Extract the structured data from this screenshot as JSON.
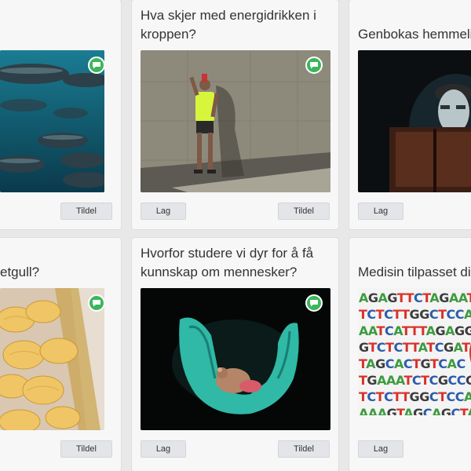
{
  "cards": [
    {
      "id": "fish",
      "title": "",
      "button": "Tildel"
    },
    {
      "id": "energy",
      "title": "Hva skjer med energidrikken i kroppen?",
      "buttons": [
        "Lag",
        "Tildel"
      ]
    },
    {
      "id": "genbok",
      "title": "Genbokas hemmelig",
      "buttons": [
        "Lag"
      ]
    },
    {
      "id": "chips",
      "title": "etgull?",
      "button": "Tildel"
    },
    {
      "id": "mouse",
      "title": "Hvorfor studere vi dyr for å få kunnskap om mennesker?",
      "buttons": [
        "Lag",
        "Tildel"
      ]
    },
    {
      "id": "dna",
      "title": "Medisin tilpasset din",
      "buttons": [
        "Lag"
      ]
    }
  ],
  "icons": {
    "discussion": "chat-bubble-icon"
  },
  "colors": {
    "accent": "#3bb65b",
    "card_bg": "#f7f7f7",
    "page_bg": "#e8e8e8",
    "button_bg": "#e3e5e8"
  },
  "dna_sequence": [
    "AGAGTTCTAGAAT",
    "TCTCTTGGCTCCAG",
    "AATCATTTAGAGGA",
    "GTCTCTTATCGATG",
    "TAGCACTGTCAC",
    "TGAAATCTCGCCG",
    "TCTCTTGGCTCCAG",
    "AAAGTAGCAGCTA"
  ]
}
